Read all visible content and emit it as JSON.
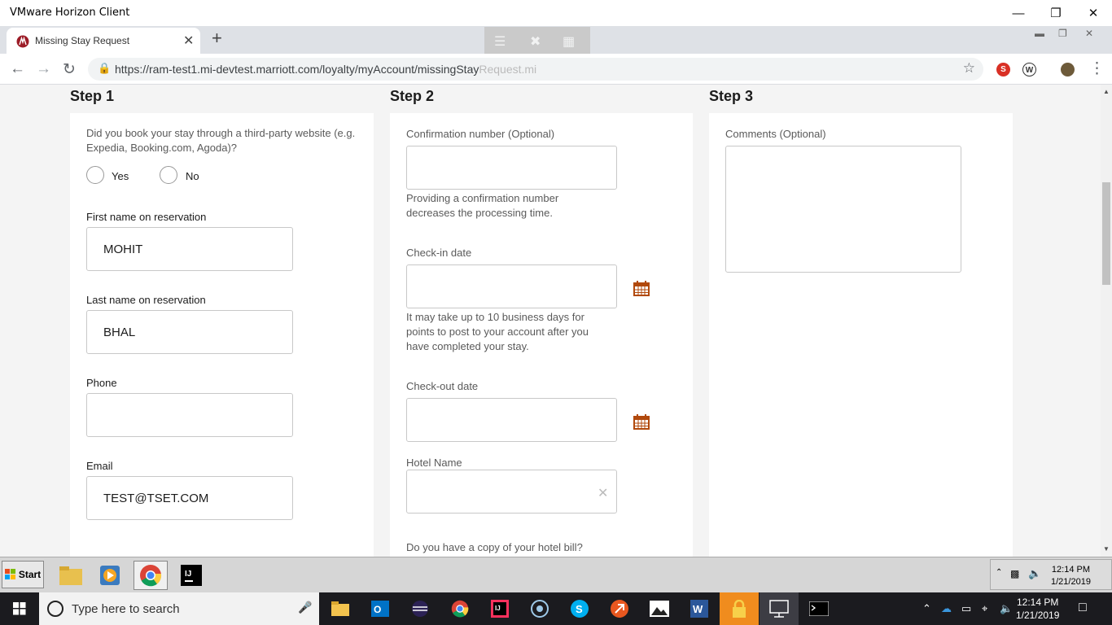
{
  "vm_window": {
    "title": "VMware Horizon Client",
    "minimize": "—",
    "restore": "❐",
    "close": "✕"
  },
  "browser": {
    "tab_title": "Missing Stay Request",
    "tab_close": "✕",
    "new_tab": "+",
    "url_main": "https://ram-test1.mi-devtest.marriott.com/loyalty/myAccount/missingStay",
    "url_faded": "Request.mi"
  },
  "steps": {
    "step1": "Step 1",
    "step2": "Step 2",
    "step3": "Step 3"
  },
  "step1": {
    "third_party_question": "Did you book your stay through a third-party website (e.g. Expedia, Booking.com, Agoda)?",
    "yes_label": "Yes",
    "no_label": "No",
    "first_name_label": "First name on reservation",
    "first_name_value": "MOHIT",
    "last_name_label": "Last name on reservation",
    "last_name_value": "BHAL",
    "phone_label": "Phone",
    "phone_value": "",
    "email_label": "Email",
    "email_value": "TEST@TSET.COM"
  },
  "step2": {
    "confirmation_label": "Confirmation number (Optional)",
    "confirmation_value": "",
    "confirmation_note": "Providing a confirmation number decreases the processing time.",
    "checkin_label": "Check-in date",
    "checkin_value": "",
    "checkin_note": "It may take up to 10 business days for points to post to your account after you have completed your stay.",
    "checkout_label": "Check-out date",
    "checkout_value": "",
    "hotel_label": "Hotel Name",
    "hotel_value": "",
    "hotel_clear": "✕",
    "bill_question": "Do you have a copy of your hotel bill?"
  },
  "step3": {
    "comments_label": "Comments (Optional)",
    "comments_value": ""
  },
  "vm_taskbar": {
    "start_label": "Start",
    "clock_time": "12:14 PM",
    "clock_date": "1/21/2019"
  },
  "win_taskbar": {
    "search_placeholder": "Type here to search",
    "clock_time": "12:14 PM",
    "clock_date": "1/21/2019"
  },
  "colors": {
    "accent_calendar": "#b1490c",
    "card_bg": "#ffffff",
    "page_bg": "#f4f4f4"
  }
}
